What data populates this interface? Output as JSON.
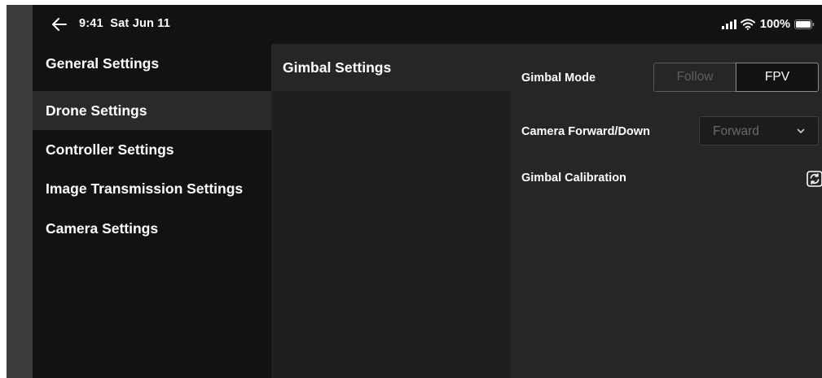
{
  "status_bar": {
    "time": "9:41",
    "date": "Sat Jun 11",
    "battery": "100%",
    "icons": [
      "back-arrow-icon",
      "cellular-signal-icon",
      "wifi-icon",
      "battery-icon"
    ]
  },
  "nav": {
    "items": [
      {
        "label": "General Settings",
        "active": false
      },
      {
        "label": "Drone Settings",
        "active": true
      },
      {
        "label": "Controller Settings",
        "active": false
      },
      {
        "label": "Image Transmission Settings",
        "active": false
      },
      {
        "label": "Camera Settings",
        "active": false
      }
    ]
  },
  "middle": {
    "items": [
      {
        "label": "Gimbal Settings",
        "active": true
      }
    ]
  },
  "detail": {
    "gimbal_mode": {
      "label": "Gimbal Mode",
      "options": [
        "Follow",
        "FPV"
      ],
      "selected": "FPV"
    },
    "camera_direction": {
      "label": "Camera Forward/Down",
      "value": "Forward"
    },
    "gimbal_calibration": {
      "label": "Gimbal Calibration",
      "icon": "refresh-icon"
    }
  },
  "colors": {
    "background": "#121212",
    "nav_active": "#2a2a2a",
    "middle_pane": "#1f1f1f",
    "detail_pane": "#262626",
    "edge_strip": "#3d3d3d",
    "text": "#ffffff",
    "muted_text": "#5e5e5e"
  }
}
